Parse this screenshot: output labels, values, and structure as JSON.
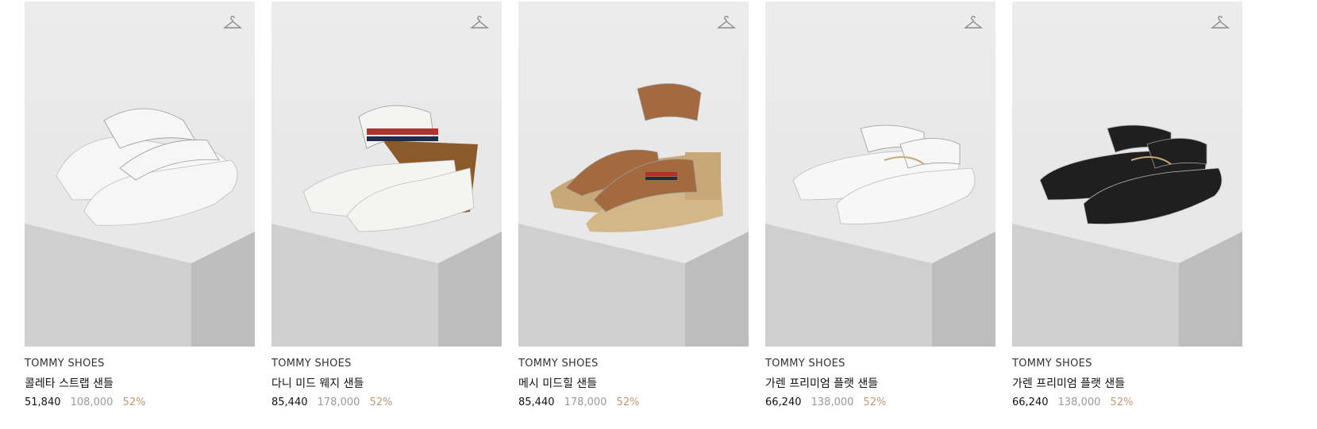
{
  "colors": {
    "discount": "#c19a72",
    "original_price": "#9a9a9a",
    "marble": "#d7d7d7"
  },
  "products": [
    {
      "brand": "TOMMY SHOES",
      "name": "콜레타 스트랩 샌들",
      "price": "51,840",
      "original_price": "108,000",
      "discount": "52%",
      "shoe_color": "#f6f6f6",
      "icon": "hanger-icon"
    },
    {
      "brand": "TOMMY SHOES",
      "name": "다니 미드 웨지 샌들",
      "price": "85,440",
      "original_price": "178,000",
      "discount": "52%",
      "shoe_color": "#f4f4f2",
      "icon": "hanger-icon"
    },
    {
      "brand": "TOMMY SHOES",
      "name": "메시 미드힐 샌들",
      "price": "85,440",
      "original_price": "178,000",
      "discount": "52%",
      "shoe_color": "#a46a3f",
      "icon": "hanger-icon"
    },
    {
      "brand": "TOMMY SHOES",
      "name": "가렌 프리미엄 플랫 샌들",
      "price": "66,240",
      "original_price": "138,000",
      "discount": "52%",
      "shoe_color": "#f7f7f7",
      "icon": "hanger-icon"
    },
    {
      "brand": "TOMMY SHOES",
      "name": "가렌 프리미엄 플랫 샌들",
      "price": "66,240",
      "original_price": "138,000",
      "discount": "52%",
      "shoe_color": "#1f1f1f",
      "icon": "hanger-icon"
    }
  ]
}
